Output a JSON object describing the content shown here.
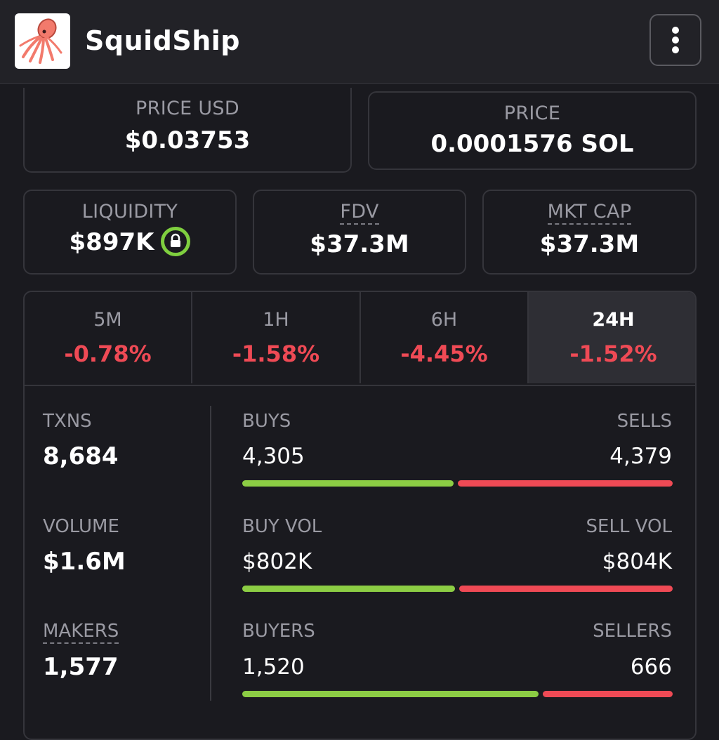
{
  "header": {
    "app_name": "SquidShip",
    "logo_icon": "squid-logo-icon",
    "menu_icon": "vertical-dots-icon"
  },
  "price_usd": {
    "label": "PRICE USD",
    "value": "$0.03753"
  },
  "price_native": {
    "label": "PRICE",
    "value": "0.0001576 SOL"
  },
  "liquidity": {
    "label": "LIQUIDITY",
    "value": "$897K",
    "badge_icon": "lock-icon"
  },
  "fdv": {
    "label": "FDV",
    "value": "$37.3M"
  },
  "mkt_cap": {
    "label": "MKT CAP",
    "value": "$37.3M"
  },
  "timeframes": [
    {
      "label": "5M",
      "change": "-0.78%"
    },
    {
      "label": "1H",
      "change": "-1.58%"
    },
    {
      "label": "6H",
      "change": "-4.45%"
    },
    {
      "label": "24H",
      "change": "-1.52%",
      "active": true
    }
  ],
  "stats": {
    "txns": {
      "label": "TXNS",
      "value": "8,684"
    },
    "volume": {
      "label": "VOLUME",
      "value": "$1.6M"
    },
    "makers": {
      "label": "MAKERS",
      "value": "1,577"
    }
  },
  "breakdown": {
    "buys": {
      "label": "BUYS",
      "value": "4,305"
    },
    "sells": {
      "label": "SELLS",
      "value": "4,379"
    },
    "buy_vol": {
      "label": "BUY VOL",
      "value": "$802K"
    },
    "sell_vol": {
      "label": "SELL VOL",
      "value": "$804K"
    },
    "buyers": {
      "label": "BUYERS",
      "value": "1,520"
    },
    "sellers": {
      "label": "SELLERS",
      "value": "666"
    },
    "buy_share": {
      "txns": 0.496,
      "volume": 0.499,
      "makers": 0.695
    }
  },
  "colors": {
    "positive": "#8ccd44",
    "negative": "#ef4a55",
    "background": "#1a1a1f",
    "lock_ring": "#7fcf3f"
  }
}
